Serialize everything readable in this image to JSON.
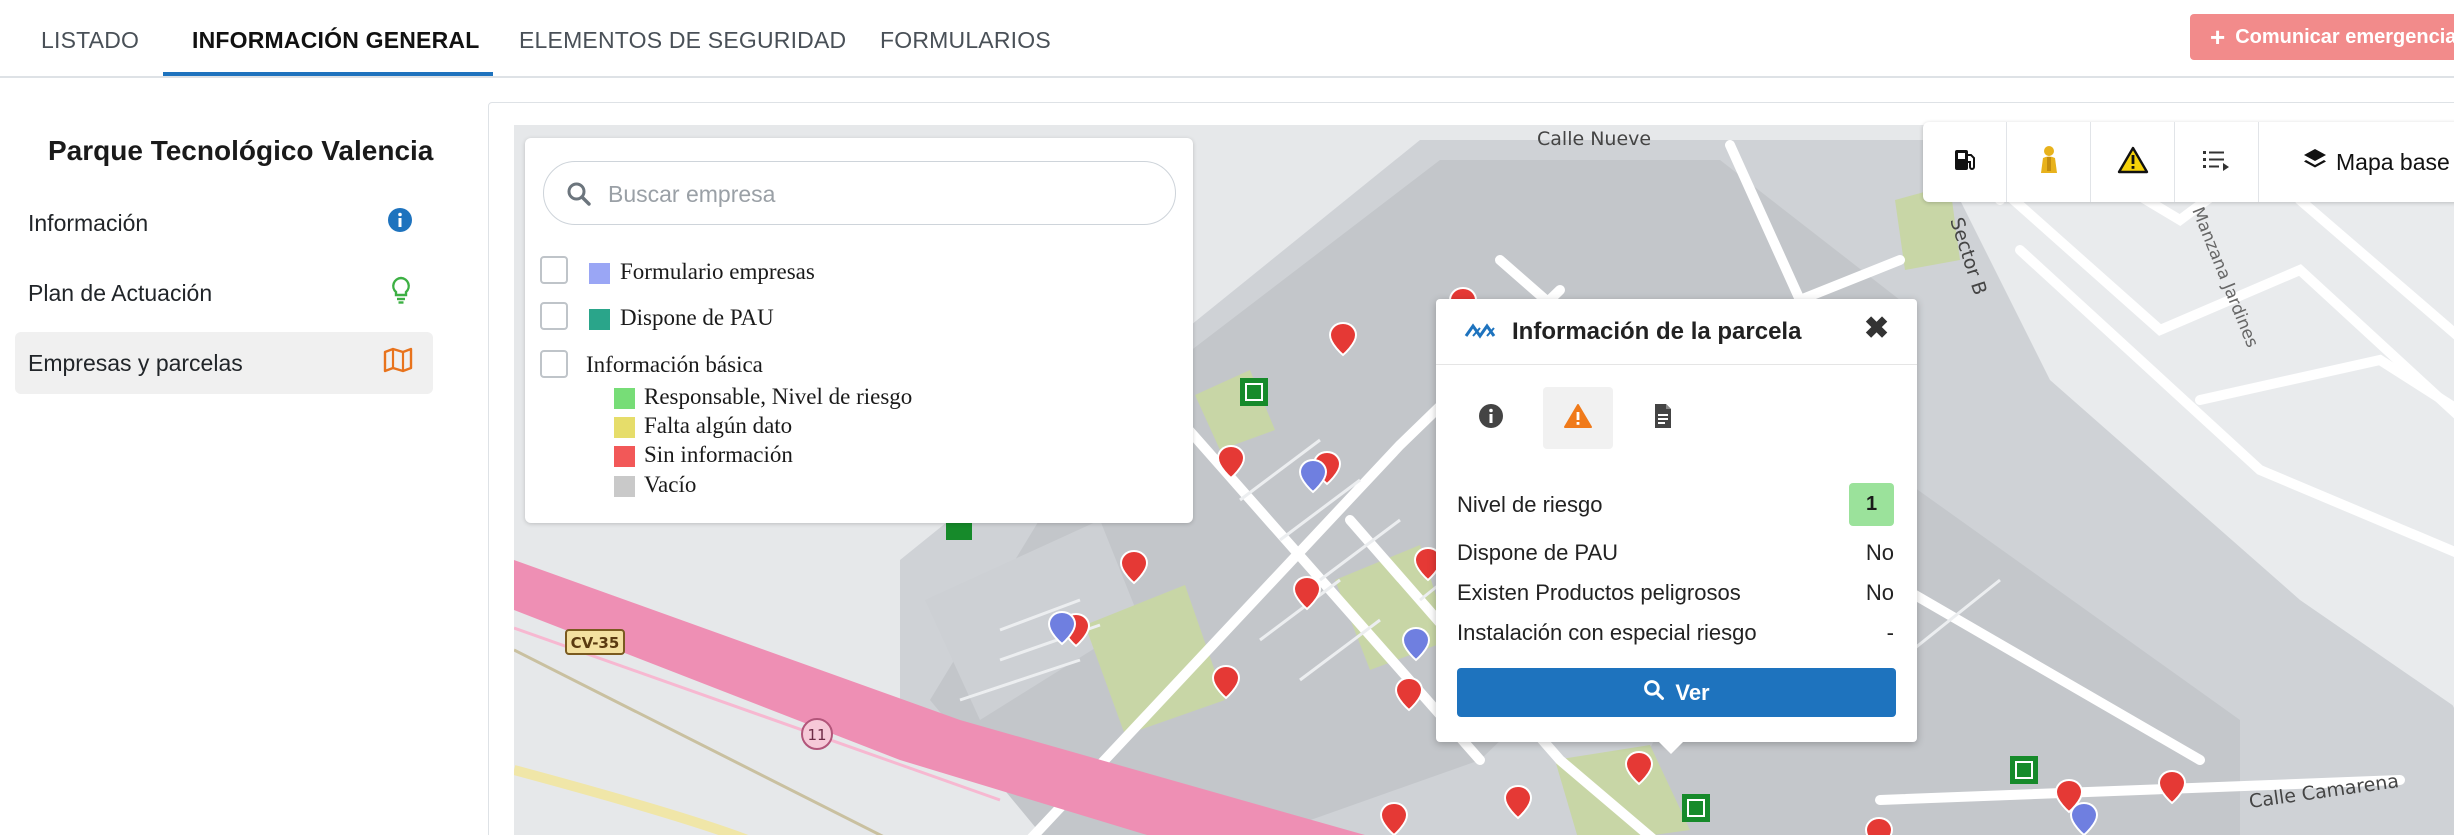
{
  "tabs": [
    {
      "label": "LISTADO"
    },
    {
      "label": "INFORMACIÓN GENERAL"
    },
    {
      "label": "ELEMENTOS DE SEGURIDAD"
    },
    {
      "label": "FORMULARIOS"
    }
  ],
  "emergency_button": {
    "label": "Comunicar emergencia"
  },
  "sidebar": {
    "title": "Parque Tecnológico Valencia",
    "items": [
      {
        "label": "Información",
        "icon": "info-icon"
      },
      {
        "label": "Plan de Actuación",
        "icon": "lightbulb-icon"
      },
      {
        "label": "Empresas y parcelas",
        "icon": "map-icon"
      }
    ]
  },
  "map": {
    "search_placeholder": "Buscar empresa",
    "layers": [
      {
        "label": "Formulario empresas",
        "color": "#9aa6f5"
      },
      {
        "label": "Dispone de PAU",
        "color": "#2aa58a"
      },
      {
        "label": "Información básica"
      }
    ],
    "legend_items": [
      {
        "label": "Responsable, Nivel de riesgo",
        "color": "#77dd77"
      },
      {
        "label": "Falta algún dato",
        "color": "#e6dd6a"
      },
      {
        "label": "Sin información",
        "color": "#f25858"
      },
      {
        "label": "Vacío",
        "color": "#c9c9c9"
      }
    ],
    "toolbar": {
      "buttons": [
        "fuel-station-icon",
        "person-icon",
        "warning-icon",
        "list-icon"
      ],
      "basemap_label": "Mapa base"
    },
    "street_labels": [
      "Calle Nueve",
      "Sector B",
      "Manzana Jardines",
      "Calle Camarena"
    ],
    "road_labels": [
      "CV-35",
      "11"
    ]
  },
  "popup": {
    "title": "Información de la parcela",
    "tabs": [
      "info-icon",
      "warning-icon",
      "document-icon"
    ],
    "rows": [
      {
        "label": "Nivel de riesgo",
        "value": "1"
      },
      {
        "label": "Dispone de PAU",
        "value": "No"
      },
      {
        "label": "Existen Productos peligrosos",
        "value": "No"
      },
      {
        "label": "Instalación con especial riesgo",
        "value": "-"
      }
    ],
    "button_label": "Ver"
  }
}
